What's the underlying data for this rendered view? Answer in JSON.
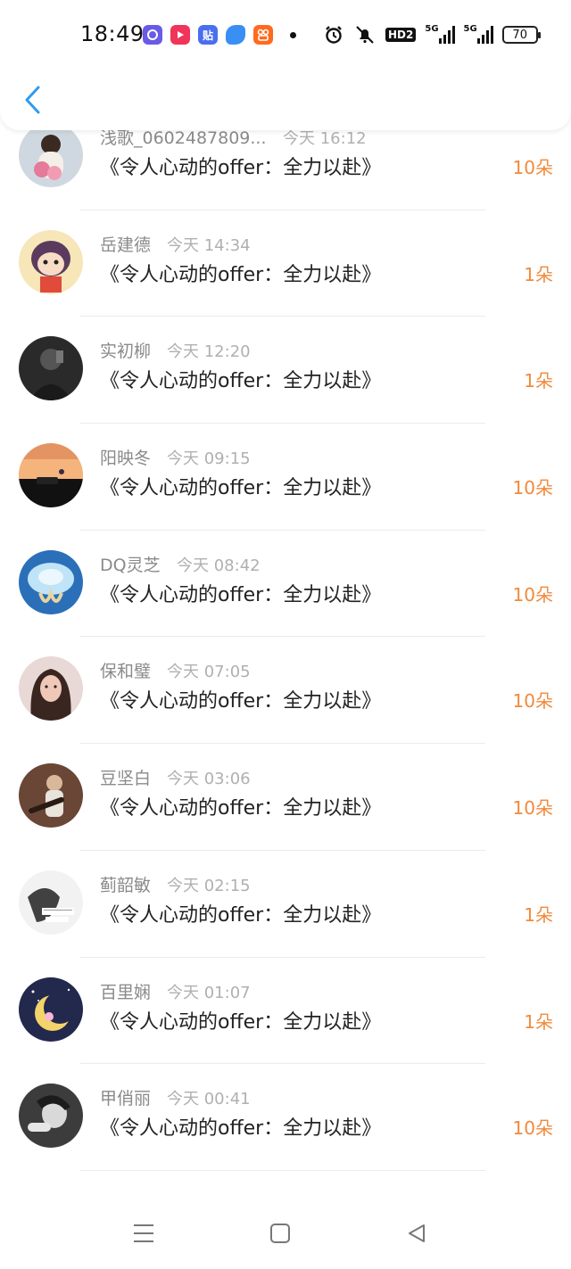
{
  "status_bar": {
    "time": "18:49",
    "apps": [
      {
        "icon": "circle-app-icon",
        "color": "#6a5be6",
        "text": ""
      },
      {
        "icon": "video-play-icon",
        "color": "#f0345a",
        "text": ""
      },
      {
        "icon": "tieba-icon",
        "color": "#4a6ef0",
        "text": "贴"
      },
      {
        "icon": "blue-app-icon",
        "color": "#3a8ff5",
        "text": ""
      },
      {
        "icon": "kuaishou-icon",
        "color": "#ff6a1e",
        "text": ""
      }
    ],
    "network": [
      "HD2",
      "5G",
      "5G"
    ],
    "battery": "70"
  },
  "header": {
    "back_icon": "chevron-left-icon",
    "accent": "#2f9bf0"
  },
  "list": {
    "items": [
      {
        "name": "浅歌_0602487809...",
        "time": "今天 16:12",
        "title": "《令人心动的offer：全力以赴》",
        "count": "10朵"
      },
      {
        "name": "岳建德",
        "time": "今天 14:34",
        "title": "《令人心动的offer：全力以赴》",
        "count": "1朵"
      },
      {
        "name": "实初柳",
        "time": "今天 12:20",
        "title": "《令人心动的offer：全力以赴》",
        "count": "1朵"
      },
      {
        "name": "阳映冬",
        "time": "今天 09:15",
        "title": "《令人心动的offer：全力以赴》",
        "count": "10朵"
      },
      {
        "name": "DQ灵芝",
        "time": "今天 08:42",
        "title": "《令人心动的offer：全力以赴》",
        "count": "10朵"
      },
      {
        "name": "保和璧",
        "time": "今天 07:05",
        "title": "《令人心动的offer：全力以赴》",
        "count": "10朵"
      },
      {
        "name": "豆坚白",
        "time": "今天 03:06",
        "title": "《令人心动的offer：全力以赴》",
        "count": "10朵"
      },
      {
        "name": "蓟韶敏",
        "time": "今天 02:15",
        "title": "《令人心动的offer：全力以赴》",
        "count": "1朵"
      },
      {
        "name": "百里娴",
        "time": "今天 01:07",
        "title": "《令人心动的offer：全力以赴》",
        "count": "1朵"
      },
      {
        "name": "甲俏丽",
        "time": "今天 00:41",
        "title": "《令人心动的offer：全力以赴》",
        "count": "10朵"
      }
    ],
    "count_color": "#f08a3c"
  },
  "bottom_nav": {
    "icons": [
      "menu-icon",
      "home-square-icon",
      "back-triangle-icon"
    ]
  }
}
